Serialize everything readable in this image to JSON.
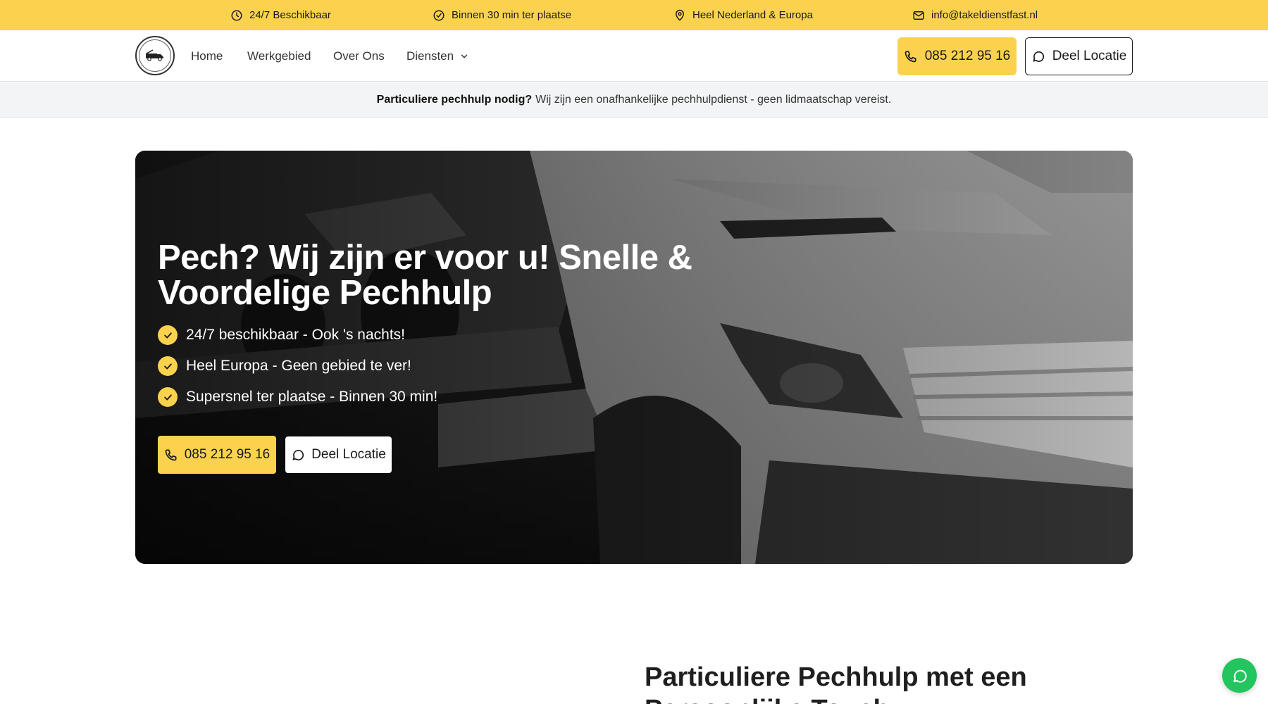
{
  "topbar": {
    "items": [
      {
        "icon": "clock-icon",
        "label": "24/7 Beschikbaar"
      },
      {
        "icon": "check-circle-icon",
        "label": "Binnen 30 min ter plaatse"
      },
      {
        "icon": "map-pin-icon",
        "label": "Heel Nederland & Europa"
      },
      {
        "icon": "mail-icon",
        "label": "info@takeldienstfast.nl"
      }
    ]
  },
  "nav": {
    "links": [
      "Home",
      "Werkgebied",
      "Over Ons",
      "Diensten"
    ],
    "phone_label": "085 212 95 16",
    "location_label": "Deel Locatie"
  },
  "notice": {
    "bold": "Particuliere pechhulp nodig?",
    "text": "Wij zijn een onafhankelijke pechhulpdienst - geen lidmaatschap vereist."
  },
  "hero": {
    "title_line1": "Pech? Wij zijn er voor u! Snelle &",
    "title_line2": "Voordelige Pechhulp",
    "features": [
      "24/7 beschikbaar - Ook 's nachts!",
      "Heel Europa - Geen gebied te ver!",
      "Supersnel ter plaatse - Binnen 30 min!"
    ],
    "phone_label": "085 212 95 16",
    "location_label": "Deel Locatie"
  },
  "section": {
    "title": "Particuliere Pechhulp met een Persoonlijke Touch"
  },
  "colors": {
    "accent": "#fbd24e",
    "chat": "#22c55e"
  }
}
